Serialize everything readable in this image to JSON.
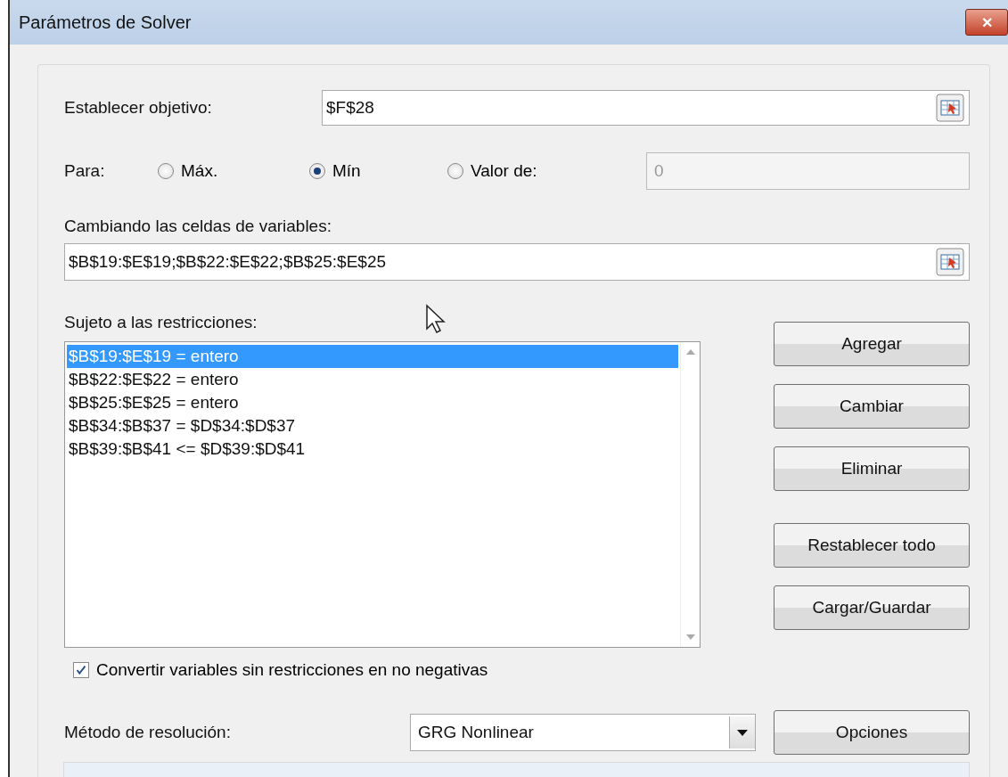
{
  "window": {
    "title": "Parámetros de Solver",
    "close": "✕"
  },
  "objective": {
    "label": "Establecer objetivo:",
    "value": "$F$28"
  },
  "to": {
    "label": "Para:",
    "options": [
      {
        "label": "Máx.",
        "selected": false
      },
      {
        "label": "Mín",
        "selected": true
      },
      {
        "label": "Valor de:",
        "selected": false
      }
    ],
    "value_field": {
      "value": "0",
      "disabled": true
    }
  },
  "variables": {
    "label": "Cambiando las celdas de variables:",
    "value": "$B$19:$E$19;$B$22:$E$22;$B$25:$E$25"
  },
  "constraints": {
    "label": "Sujeto a las restricciones:",
    "items": [
      {
        "text": "$B$19:$E$19 = entero",
        "selected": true
      },
      {
        "text": "$B$22:$E$22 = entero",
        "selected": false
      },
      {
        "text": "$B$25:$E$25 = entero",
        "selected": false
      },
      {
        "text": "$B$34:$B$37 = $D$34:$D$37",
        "selected": false
      },
      {
        "text": "$B$39:$B$41 <= $D$39:$D$41",
        "selected": false
      }
    ]
  },
  "constraint_buttons": [
    {
      "label": "Agregar"
    },
    {
      "label": "Cambiar"
    },
    {
      "label": "Eliminar"
    }
  ],
  "model_buttons": [
    {
      "label": "Restablecer todo"
    },
    {
      "label": "Cargar/Guardar"
    }
  ],
  "nonnegative": {
    "label": "Convertir variables sin restricciones en no negativas",
    "checked": true
  },
  "method": {
    "label": "Método de resolución:",
    "value": "GRG Nonlinear"
  },
  "options_button": {
    "label": "Opciones"
  }
}
